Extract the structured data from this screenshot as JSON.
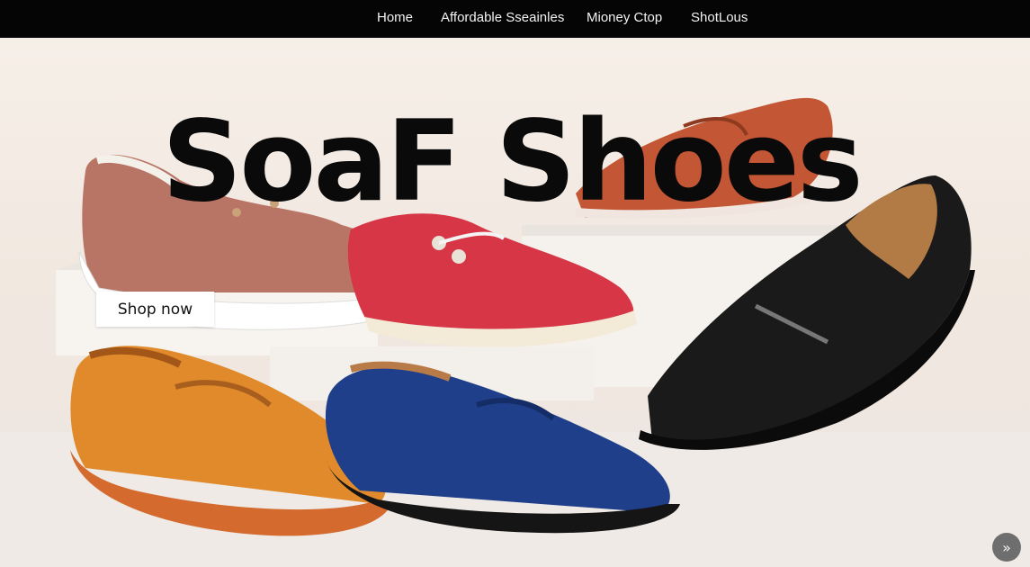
{
  "nav": {
    "items": [
      {
        "label": "Home"
      },
      {
        "label": "Affordable Sseainles"
      },
      {
        "label": "Mioney Ctop"
      },
      {
        "label": "ShotLous"
      }
    ]
  },
  "hero": {
    "headline": "SoaF Shoes",
    "shop_button_label": "Shop now",
    "next_icon": "chevron-double-right-icon",
    "next_glyph": "»"
  },
  "colors": {
    "nav_background": "#050505",
    "headline": "#0a0a0a",
    "shoe_pink": "#b87565",
    "shoe_red": "#d63645",
    "shoe_rust": "#c35634",
    "shoe_black": "#1a1a1a",
    "shoe_orange": "#e08a2b",
    "shoe_navy": "#1f3f8a"
  }
}
